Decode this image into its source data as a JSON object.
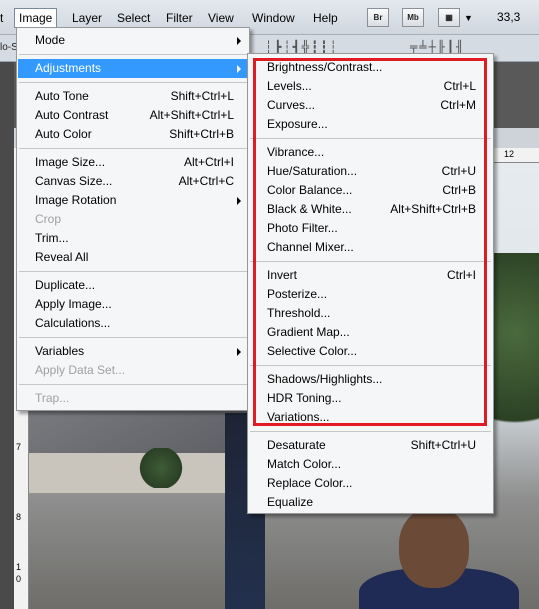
{
  "menubar": {
    "items": [
      {
        "label": "t",
        "active": false
      },
      {
        "label": "Image",
        "active": true
      },
      {
        "label": "Layer",
        "active": false
      },
      {
        "label": "Select",
        "active": false
      },
      {
        "label": "Filter",
        "active": false
      },
      {
        "label": "View",
        "active": false
      },
      {
        "label": "Window",
        "active": false
      },
      {
        "label": "Help",
        "active": false
      }
    ],
    "buttons": [
      {
        "label": "Br"
      },
      {
        "label": "Mb"
      }
    ],
    "zoom": "33,3"
  },
  "doc_tab": "lo-Se",
  "ruler_top_label": "12",
  "ruler_left_labels": [
    "7",
    "8",
    "1",
    "0"
  ],
  "image_menu": [
    {
      "label": "Mode",
      "shortcut": "",
      "submenu": true
    },
    {
      "separator": true
    },
    {
      "label": "Adjustments",
      "shortcut": "",
      "submenu": true,
      "highlighted": true
    },
    {
      "separator": true
    },
    {
      "label": "Auto Tone",
      "shortcut": "Shift+Ctrl+L"
    },
    {
      "label": "Auto Contrast",
      "shortcut": "Alt+Shift+Ctrl+L"
    },
    {
      "label": "Auto Color",
      "shortcut": "Shift+Ctrl+B"
    },
    {
      "separator": true
    },
    {
      "label": "Image Size...",
      "shortcut": "Alt+Ctrl+I"
    },
    {
      "label": "Canvas Size...",
      "shortcut": "Alt+Ctrl+C"
    },
    {
      "label": "Image Rotation",
      "shortcut": "",
      "submenu": true
    },
    {
      "label": "Crop",
      "shortcut": "",
      "disabled": true
    },
    {
      "label": "Trim...",
      "shortcut": ""
    },
    {
      "label": "Reveal All",
      "shortcut": ""
    },
    {
      "separator": true
    },
    {
      "label": "Duplicate...",
      "shortcut": ""
    },
    {
      "label": "Apply Image...",
      "shortcut": ""
    },
    {
      "label": "Calculations...",
      "shortcut": ""
    },
    {
      "separator": true
    },
    {
      "label": "Variables",
      "shortcut": "",
      "submenu": true
    },
    {
      "label": "Apply Data Set...",
      "shortcut": "",
      "disabled": true
    },
    {
      "separator": true
    },
    {
      "label": "Trap...",
      "shortcut": "",
      "disabled": true
    }
  ],
  "adjustments_menu": [
    {
      "label": "Brightness/Contrast...",
      "shortcut": ""
    },
    {
      "label": "Levels...",
      "shortcut": "Ctrl+L"
    },
    {
      "label": "Curves...",
      "shortcut": "Ctrl+M"
    },
    {
      "label": "Exposure...",
      "shortcut": ""
    },
    {
      "separator": true
    },
    {
      "label": "Vibrance...",
      "shortcut": ""
    },
    {
      "label": "Hue/Saturation...",
      "shortcut": "Ctrl+U"
    },
    {
      "label": "Color Balance...",
      "shortcut": "Ctrl+B"
    },
    {
      "label": "Black & White...",
      "shortcut": "Alt+Shift+Ctrl+B"
    },
    {
      "label": "Photo Filter...",
      "shortcut": ""
    },
    {
      "label": "Channel Mixer...",
      "shortcut": ""
    },
    {
      "separator": true
    },
    {
      "label": "Invert",
      "shortcut": "Ctrl+I"
    },
    {
      "label": "Posterize...",
      "shortcut": ""
    },
    {
      "label": "Threshold...",
      "shortcut": ""
    },
    {
      "label": "Gradient Map...",
      "shortcut": ""
    },
    {
      "label": "Selective Color...",
      "shortcut": ""
    },
    {
      "separator": true
    },
    {
      "label": "Shadows/Highlights...",
      "shortcut": ""
    },
    {
      "label": "HDR Toning...",
      "shortcut": ""
    },
    {
      "label": "Variations...",
      "shortcut": ""
    },
    {
      "separator": true
    },
    {
      "label": "Desaturate",
      "shortcut": "Shift+Ctrl+U"
    },
    {
      "label": "Match Color...",
      "shortcut": ""
    },
    {
      "label": "Replace Color...",
      "shortcut": ""
    },
    {
      "label": "Equalize",
      "shortcut": ""
    }
  ],
  "colors": {
    "highlight": "#3399ff",
    "annotation": "#e01b24"
  }
}
